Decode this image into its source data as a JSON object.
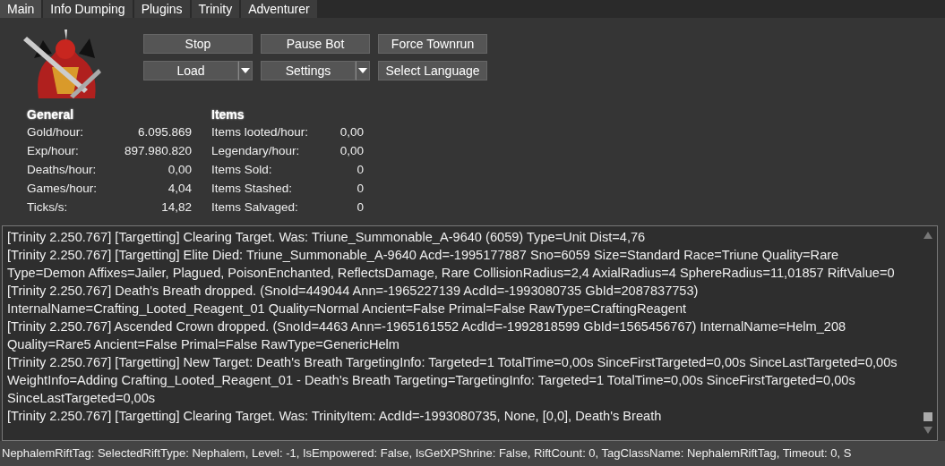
{
  "tabs": [
    {
      "label": "Main",
      "selected": true
    },
    {
      "label": "Info Dumping",
      "selected": false
    },
    {
      "label": "Plugins",
      "selected": false
    },
    {
      "label": "Trinity",
      "selected": false
    },
    {
      "label": "Adventurer",
      "selected": false
    }
  ],
  "buttons": [
    {
      "label": "Stop",
      "kind": "plain"
    },
    {
      "label": "Pause Bot",
      "kind": "plain"
    },
    {
      "label": "Force Townrun",
      "kind": "plain"
    },
    {
      "label": "Load",
      "kind": "split"
    },
    {
      "label": "Settings",
      "kind": "split"
    },
    {
      "label": "Select Language",
      "kind": "plain"
    }
  ],
  "general": {
    "heading": "General",
    "rows": [
      {
        "label": "Gold/hour:",
        "value": "6.095.869"
      },
      {
        "label": "Exp/hour:",
        "value": "897.980.820"
      },
      {
        "label": "Deaths/hour:",
        "value": "0,00"
      },
      {
        "label": "Games/hour:",
        "value": "4,04"
      },
      {
        "label": "Ticks/s:",
        "value": "14,82"
      }
    ]
  },
  "items": {
    "heading": "Items",
    "rows": [
      {
        "label": "Items looted/hour:",
        "value": "0,00"
      },
      {
        "label": "Legendary/hour:",
        "value": "0,00"
      },
      {
        "label": "Items Sold:",
        "value": "0"
      },
      {
        "label": "Items Stashed:",
        "value": "0"
      },
      {
        "label": "Items Salvaged:",
        "value": "0"
      }
    ]
  },
  "log": [
    "[Trinity 2.250.767] [Targetting]  Clearing Target. Was: Triune_Summonable_A-9640 (6059) Type=Unit Dist=4,76",
    "[Trinity 2.250.767] [Targetting]  Elite Died: Triune_Summonable_A-9640 Acd=-1995177887 Sno=6059 Size=Standard Race=Triune Quality=Rare Type=Demon Affixes=Jailer, Plagued, PoisonEnchanted, ReflectsDamage, Rare CollisionRadius=2,4 AxialRadius=4 SphereRadius=11,01857 RiftValue=0",
    "[Trinity 2.250.767] Death's Breath dropped. (SnoId=449044 Ann=-1965227139 AcdId=-1993080735 GbId=2087837753) InternalName=Crafting_Looted_Reagent_01 Quality=Normal Ancient=False Primal=False RawType=CraftingReagent",
    "[Trinity 2.250.767] Ascended Crown dropped. (SnoId=4463 Ann=-1965161552 AcdId=-1992818599 GbId=1565456767) InternalName=Helm_208 Quality=Rare5 Ancient=False Primal=False RawType=GenericHelm",
    "[Trinity 2.250.767] [Targetting]  New Target: Death's Breath TargetingInfo: Targeted=1 TotalTime=0,00s SinceFirstTargeted=0,00s SinceLastTargeted=0,00s WeightInfo=Adding Crafting_Looted_Reagent_01 - Death's Breath Targeting=TargetingInfo: Targeted=1 TotalTime=0,00s SinceFirstTargeted=0,00s SinceLastTargeted=0,00s",
    "[Trinity 2.250.767] [Targetting]  Clearing Target. Was: TrinityItem: AcdId=-1993080735, None, [0,0], Death's Breath"
  ],
  "status": "NephalemRiftTag: SelectedRiftType: Nephalem, Level: -1, IsEmpowered: False, IsGetXPShrine: False, RiftCount: 0, TagClassName: NephalemRiftTag, Timeout: 0, S"
}
